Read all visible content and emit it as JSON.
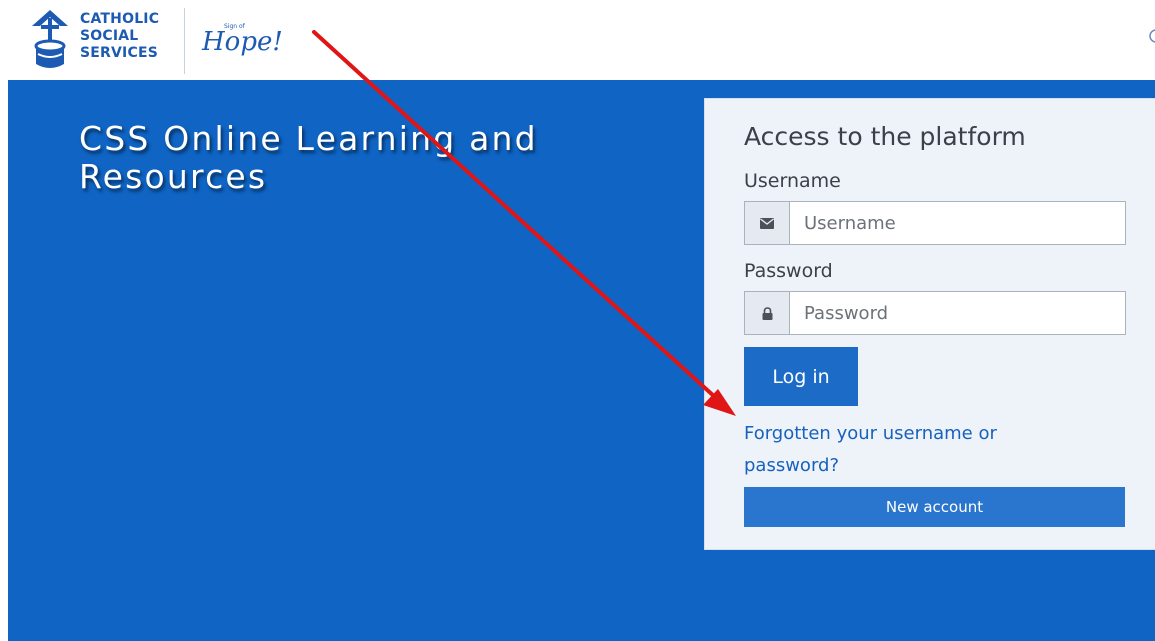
{
  "header": {
    "logo_lines": [
      "CATHOLIC",
      "SOCIAL",
      "SERVICES"
    ],
    "tagline_small": "Sign of",
    "tagline_script": "Hope!"
  },
  "hero": {
    "title": "CSS Online Learning and Resources"
  },
  "login": {
    "title": "Access to the platform",
    "username_label": "Username",
    "username_placeholder": "Username",
    "username_value": "",
    "username_icon": "envelope-icon",
    "password_label": "Password",
    "password_placeholder": "Password",
    "password_value": "",
    "password_icon": "lock-icon",
    "login_button": "Log in",
    "forgot_link": "Forgotten your username or password?",
    "new_account_button": "New account"
  },
  "colors": {
    "hero_blue": "#0f64c4",
    "brand_blue": "#1d5bb3",
    "button_blue": "#1c6bc6",
    "annotation_red": "#e01515"
  }
}
